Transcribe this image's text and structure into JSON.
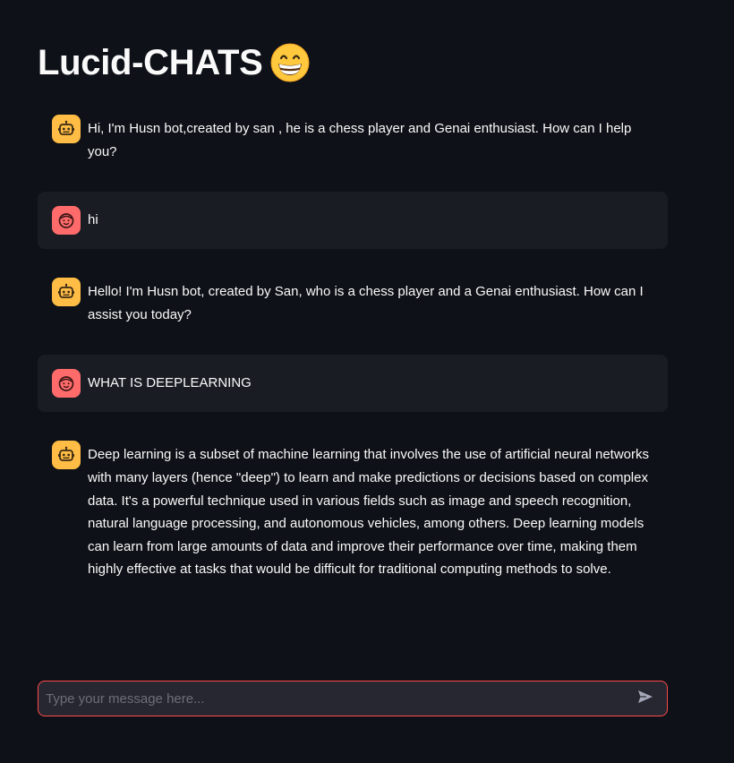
{
  "app": {
    "title": "Lucid-CHATS",
    "title_emoji_icon": "grinning-face-emoji-icon"
  },
  "messages": [
    {
      "role": "assistant",
      "avatar_icon": "robot-icon",
      "text": "Hi, I'm Husn bot,created by san , he is a chess player and Genai enthusiast. How can I help you?"
    },
    {
      "role": "user",
      "avatar_icon": "face-icon",
      "text": "hi"
    },
    {
      "role": "assistant",
      "avatar_icon": "robot-icon",
      "text": "Hello! I'm Husn bot, created by San, who is a chess player and a Genai enthusiast. How can I assist you today?"
    },
    {
      "role": "user",
      "avatar_icon": "face-icon",
      "text": "WHAT IS DEEPLEARNING"
    },
    {
      "role": "assistant",
      "avatar_icon": "robot-icon",
      "text": "Deep learning is a subset of machine learning that involves the use of artificial neural networks with many layers (hence \"deep\") to learn and make predictions or decisions based on complex data. It's a powerful technique used in various fields such as image and speech recognition, natural language processing, and autonomous vehicles, among others. Deep learning models can learn from large amounts of data and improve their performance over time, making them highly effective at tasks that would be difficult for traditional computing methods to solve."
    }
  ],
  "chat_input": {
    "placeholder": "Type your message here...",
    "value": "",
    "send_icon": "send-icon"
  },
  "colors": {
    "background": "#0e1117",
    "user_message_bg": "#1a1c24",
    "bot_avatar": "#ffbd45",
    "user_avatar": "#ff6b6b",
    "input_border_focus": "#ff4b4b",
    "input_bg": "#262730"
  }
}
